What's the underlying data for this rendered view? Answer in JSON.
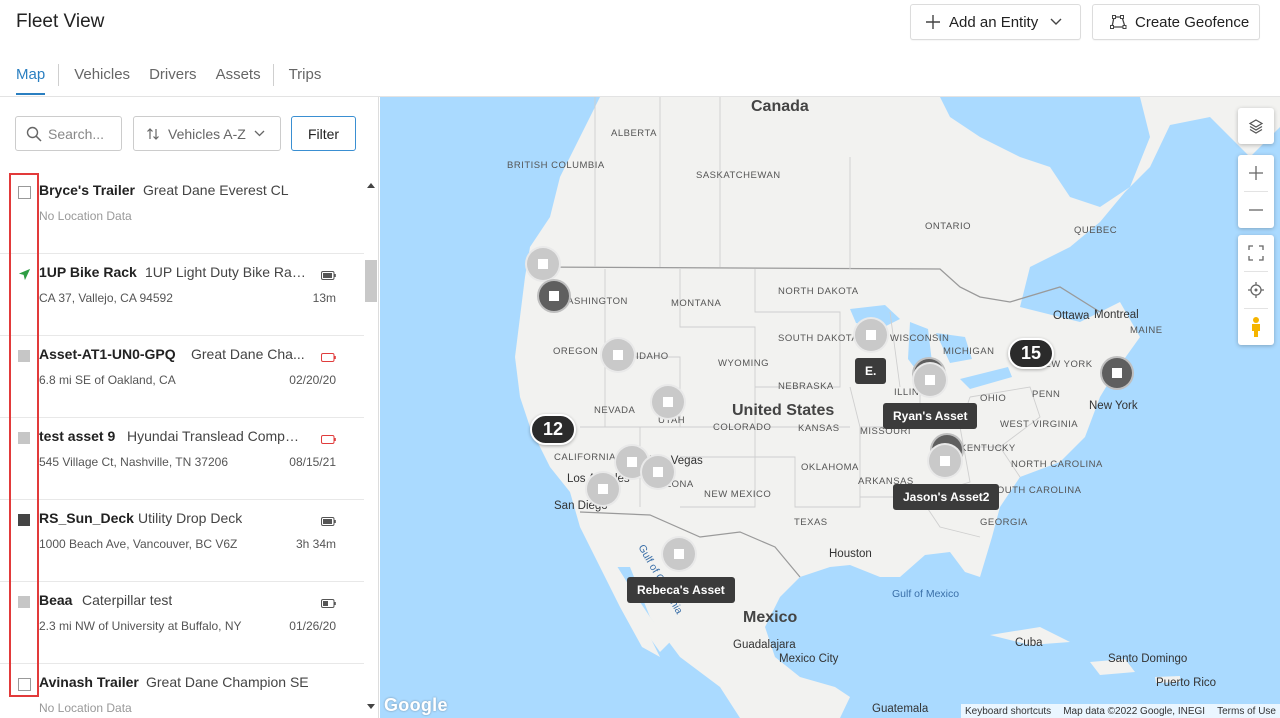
{
  "header": {
    "title": "Fleet View",
    "add_entity_label": "Add an Entity",
    "create_geofence_label": "Create Geofence"
  },
  "tabs": [
    {
      "label": "Map",
      "active": true
    },
    {
      "label": "Vehicles"
    },
    {
      "label": "Drivers"
    },
    {
      "label": "Assets"
    },
    {
      "label": "Trips"
    }
  ],
  "toolbar": {
    "search_placeholder": "Search...",
    "sort_label": "Vehicles A-Z",
    "filter_label": "Filter"
  },
  "list": [
    {
      "name": "Bryce's Trailer",
      "type": "Great Dane Everest CL",
      "location": "No Location Data",
      "time": "",
      "status": "empty",
      "battery": "none"
    },
    {
      "name": "1UP Bike Rack",
      "type": "1UP Light Duty Bike Rac...",
      "location": "CA 37, Vallejo, CA 94592",
      "time": "13m",
      "status": "moving",
      "battery": "full"
    },
    {
      "name": "Asset-AT1-UN0-GPQ",
      "type": "Great Dane Cha...",
      "location": "6.8 mi SE of Oakland, CA",
      "time": "02/20/20",
      "status": "grey",
      "battery": "low"
    },
    {
      "name": "test asset 9",
      "type": "Hyundai Translead Compo...",
      "location": "545 Village Ct, Nashville, TN 37206",
      "time": "08/15/21",
      "status": "grey",
      "battery": "low"
    },
    {
      "name": "RS_Sun_Deck",
      "type": "Utility Drop Deck",
      "location": "1000 Beach Ave, Vancouver, BC V6Z",
      "time": "3h 34m",
      "status": "dark",
      "battery": "full"
    },
    {
      "name": "Beaa",
      "type": "Caterpillar test",
      "location": "2.3 mi NW of University at Buffalo, NY",
      "time": "01/26/20",
      "status": "grey",
      "battery": "half"
    },
    {
      "name": "Avinash Trailer",
      "type": "Great Dane Champion SE",
      "location": "No Location Data",
      "time": "",
      "status": "empty",
      "battery": "none"
    }
  ],
  "colors": {
    "accent": "#2a7fc1",
    "moving": "#2e9e44",
    "battery_low": "#e03c3c",
    "highlight": "#e23a3a",
    "water": "#aadaff",
    "land": "#f2f2f0"
  },
  "map": {
    "country_labels": [
      "Canada",
      "United States",
      "Mexico"
    ],
    "region_labels": [
      "ALBERTA",
      "BRITISH COLUMBIA",
      "SASKATCHEWAN",
      "ONTARIO",
      "QUEBEC",
      "MONTANA",
      "NORTH DAKOTA",
      "SOUTH DAKOTA",
      "WISCONSIN",
      "MICHIGAN",
      "MAINE",
      "OREGON",
      "IDAHO",
      "WYOMING",
      "NEBRASKA",
      "NEVADA",
      "UTAH",
      "COLORADO",
      "KANSAS",
      "MISSOURI",
      "ILLINOIS",
      "OHIO",
      "PENN",
      "NEW YORK",
      "WEST VIRGINIA",
      "KENTUCKY",
      "NORTH CAROLINA",
      "SOUTH CAROLINA",
      "CALIFORNIA",
      "ARIZONA",
      "NEW MEXICO",
      "TEXAS",
      "OKLAHOMA",
      "ARKANSAS",
      "GEORGIA",
      "WASHINGTON"
    ],
    "city_labels": [
      "Ottawa",
      "Montreal",
      "New York",
      "Los Angeles",
      "San Diego",
      "Las Vegas",
      "Houston",
      "Guadalajara",
      "Mexico City",
      "Cuba",
      "Santo Domingo",
      "Puerto Rico",
      "Guatemala"
    ],
    "water_labels": [
      "Gulf of Mexico",
      "Gulf of California"
    ],
    "clusters": [
      "15",
      "12"
    ],
    "tooltips": [
      "E.",
      "Ryan's Asset",
      "Jason's Asset2",
      "Rebeca's Asset"
    ],
    "attribution": [
      "Keyboard shortcuts",
      "Map data ©2022 Google, INEGI",
      "Terms of Use"
    ],
    "logo": "Google"
  }
}
